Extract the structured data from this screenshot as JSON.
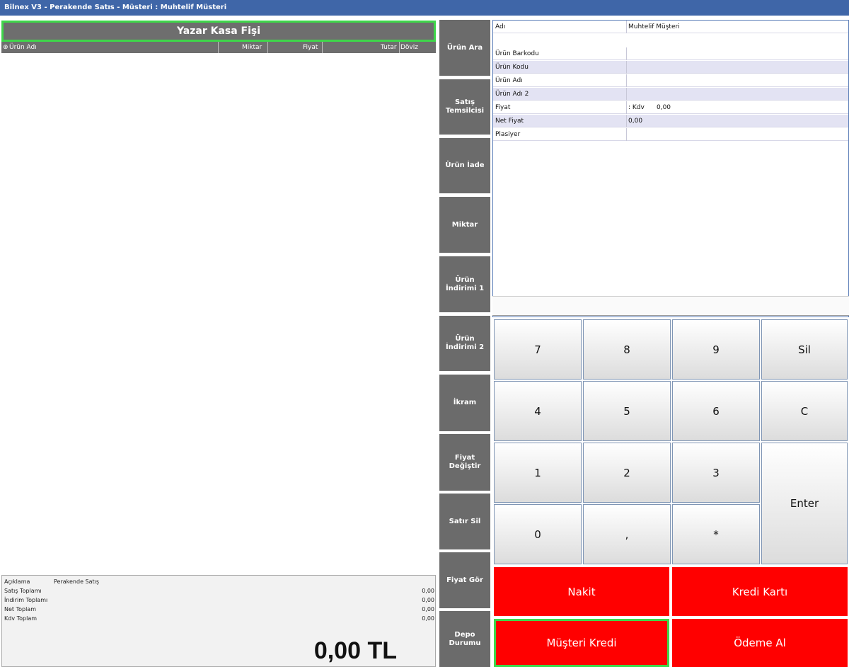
{
  "window": {
    "title": "Bilnex V3 - Perakende Satıs  -  Müsteri : Muhtelif Müsteri"
  },
  "receipt": {
    "title": "Yazar Kasa Fişi",
    "columns": [
      "Ürün Adı",
      "Miktar",
      "Fiyat",
      "Tutar",
      "Döviz"
    ]
  },
  "totals": {
    "description_label": "Açıklama",
    "description_value": "Perakende Satış",
    "rows": [
      {
        "label": "Satış Toplamı",
        "value": "0,00"
      },
      {
        "label": "İndirim Toplamı",
        "value": "0,00"
      },
      {
        "label": "Net Toplam",
        "value": "0,00"
      },
      {
        "label": "Kdv Toplam",
        "value": "0,00"
      }
    ],
    "grand_total": "0,00 TL"
  },
  "function_buttons": [
    {
      "line1": "Ürün Ara",
      "line2": ""
    },
    {
      "line1": "Satış",
      "line2": "Temsilcisi"
    },
    {
      "line1": "Ürün İade",
      "line2": ""
    },
    {
      "line1": "Miktar",
      "line2": ""
    },
    {
      "line1": "Ürün",
      "line2": "İndirimi 1"
    },
    {
      "line1": "Ürün",
      "line2": "İndirimi 2"
    },
    {
      "line1": "İkram",
      "line2": ""
    },
    {
      "line1": "Fiyat",
      "line2": "Değiştir"
    },
    {
      "line1": "Satır Sil",
      "line2": ""
    },
    {
      "line1": "Fiyat Gör",
      "line2": ""
    },
    {
      "line1": "Depo",
      "line2": "Durumu"
    }
  ],
  "product_info": {
    "customer_label": "Adı",
    "customer_value": "Muhtelif Müşteri",
    "rows": [
      {
        "label": "Ürün Barkodu",
        "value": ""
      },
      {
        "label": "Ürün Kodu",
        "value": ""
      },
      {
        "label": "Ürün Adı",
        "value": ""
      },
      {
        "label": "Ürün Adı 2",
        "value": ""
      },
      {
        "label": "Fiyat",
        "value": ": Kdv      0,00"
      },
      {
        "label": "Net Fiyat",
        "value": "0,00"
      },
      {
        "label": "Plasiyer",
        "value": ""
      }
    ]
  },
  "keypad": {
    "keys": [
      "7",
      "8",
      "9",
      "Sil",
      "4",
      "5",
      "6",
      "C",
      "1",
      "2",
      "3",
      "Enter",
      "0",
      ",",
      "*"
    ]
  },
  "payments": {
    "cash": "Nakit",
    "credit_card": "Kredi Kartı",
    "customer_credit": "Müşteri Kredi",
    "pay": "Ödeme Al"
  },
  "colors": {
    "titlebar": "#3f66a8",
    "button_gray": "#6b6b6b",
    "pay_red": "#ff0000",
    "selection_green": "#3fd64a"
  }
}
